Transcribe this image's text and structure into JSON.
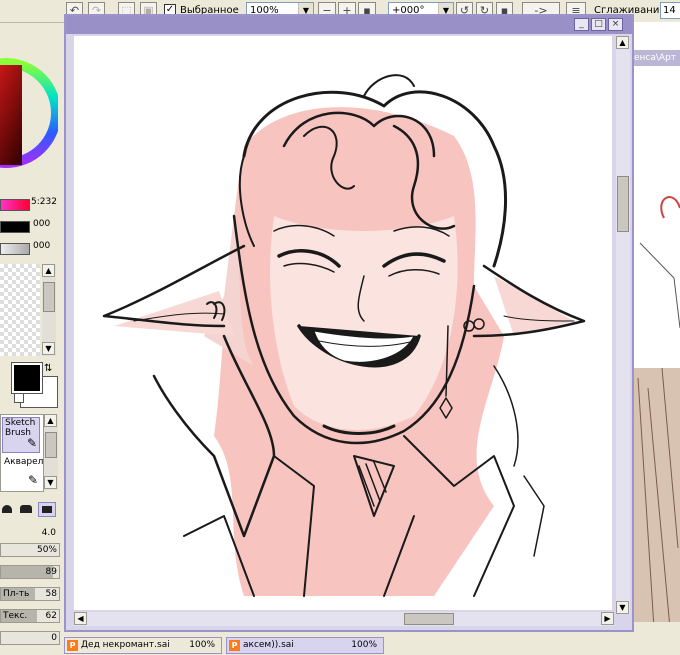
{
  "toolbar": {
    "selection_checkbox_label": "Выбранное",
    "selection_checked": true,
    "zoom_value": "100%",
    "rotation_value": "+000°",
    "flip_label": "->",
    "stabilizer_label": "Сглаживание",
    "stabilizer_value": "14"
  },
  "color_panel": {
    "slider_value_1": "5:232",
    "slider_value_2": "000",
    "slider_value_3": "000",
    "primary_color": "#000000",
    "secondary_color": "#ffffff"
  },
  "tools": {
    "tool1_line1": "Sketch",
    "tool1_line2": "Brush",
    "tool2": "Акварел"
  },
  "brush_settings": {
    "size_value": "4.0",
    "density_value": "50%",
    "field1_value": "89",
    "field2_label": "Пл-ть",
    "field2_value": "58",
    "field3_label": "Текс.",
    "field3_value": "62",
    "field4_value": "0"
  },
  "right_window": {
    "path_fragment": "енса\\Арт"
  },
  "doc_tabs": [
    {
      "name": "Дед некромант.sai",
      "zoom": "100%"
    },
    {
      "name": "аксем)).sai",
      "zoom": "100%"
    }
  ],
  "colors": {
    "accent": "#9890c6",
    "face_blush": "#f4bcb8",
    "ui_bg": "#ece9d8"
  }
}
